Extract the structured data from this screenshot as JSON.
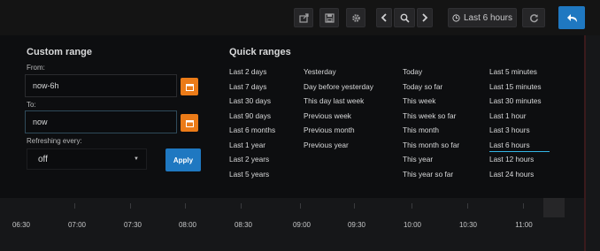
{
  "navbar": {
    "time_range_label": "Last 6 hours",
    "icons": [
      "share-icon",
      "save-icon",
      "settings-icon",
      "chevron-left-icon",
      "zoom-out-icon",
      "chevron-right-icon",
      "clock-icon",
      "refresh-icon",
      "back-icon"
    ]
  },
  "custom_range": {
    "title": "Custom range",
    "from_label": "From:",
    "from_value": "now-6h",
    "to_label": "To:",
    "to_value": "now",
    "refresh_label": "Refreshing every:",
    "refresh_value": "off",
    "apply_label": "Apply"
  },
  "quick_ranges": {
    "title": "Quick ranges",
    "columns": [
      [
        "Last 2 days",
        "Last 7 days",
        "Last 30 days",
        "Last 90 days",
        "Last 6 months",
        "Last 1 year",
        "Last 2 years",
        "Last 5 years"
      ],
      [
        "Yesterday",
        "Day before yesterday",
        "This day last week",
        "Previous week",
        "Previous month",
        "Previous year"
      ],
      [
        "Today",
        "Today so far",
        "This week",
        "This week so far",
        "This month",
        "This month so far",
        "This year",
        "This year so far"
      ],
      [
        "Last 5 minutes",
        "Last 15 minutes",
        "Last 30 minutes",
        "Last 1 hour",
        "Last 3 hours",
        "Last 6 hours",
        "Last 12 hours",
        "Last 24 hours"
      ]
    ],
    "active": "Last 6 hours"
  },
  "time_axis": {
    "ticks": [
      "06:30",
      "07:00",
      "07:30",
      "08:00",
      "08:30",
      "09:00",
      "09:30",
      "10:00",
      "10:30",
      "11:00"
    ]
  },
  "colors": {
    "accent_blue": "#1f78c1",
    "calendar_orange": "#eb7b18",
    "active_underline": "#33b5e5"
  }
}
